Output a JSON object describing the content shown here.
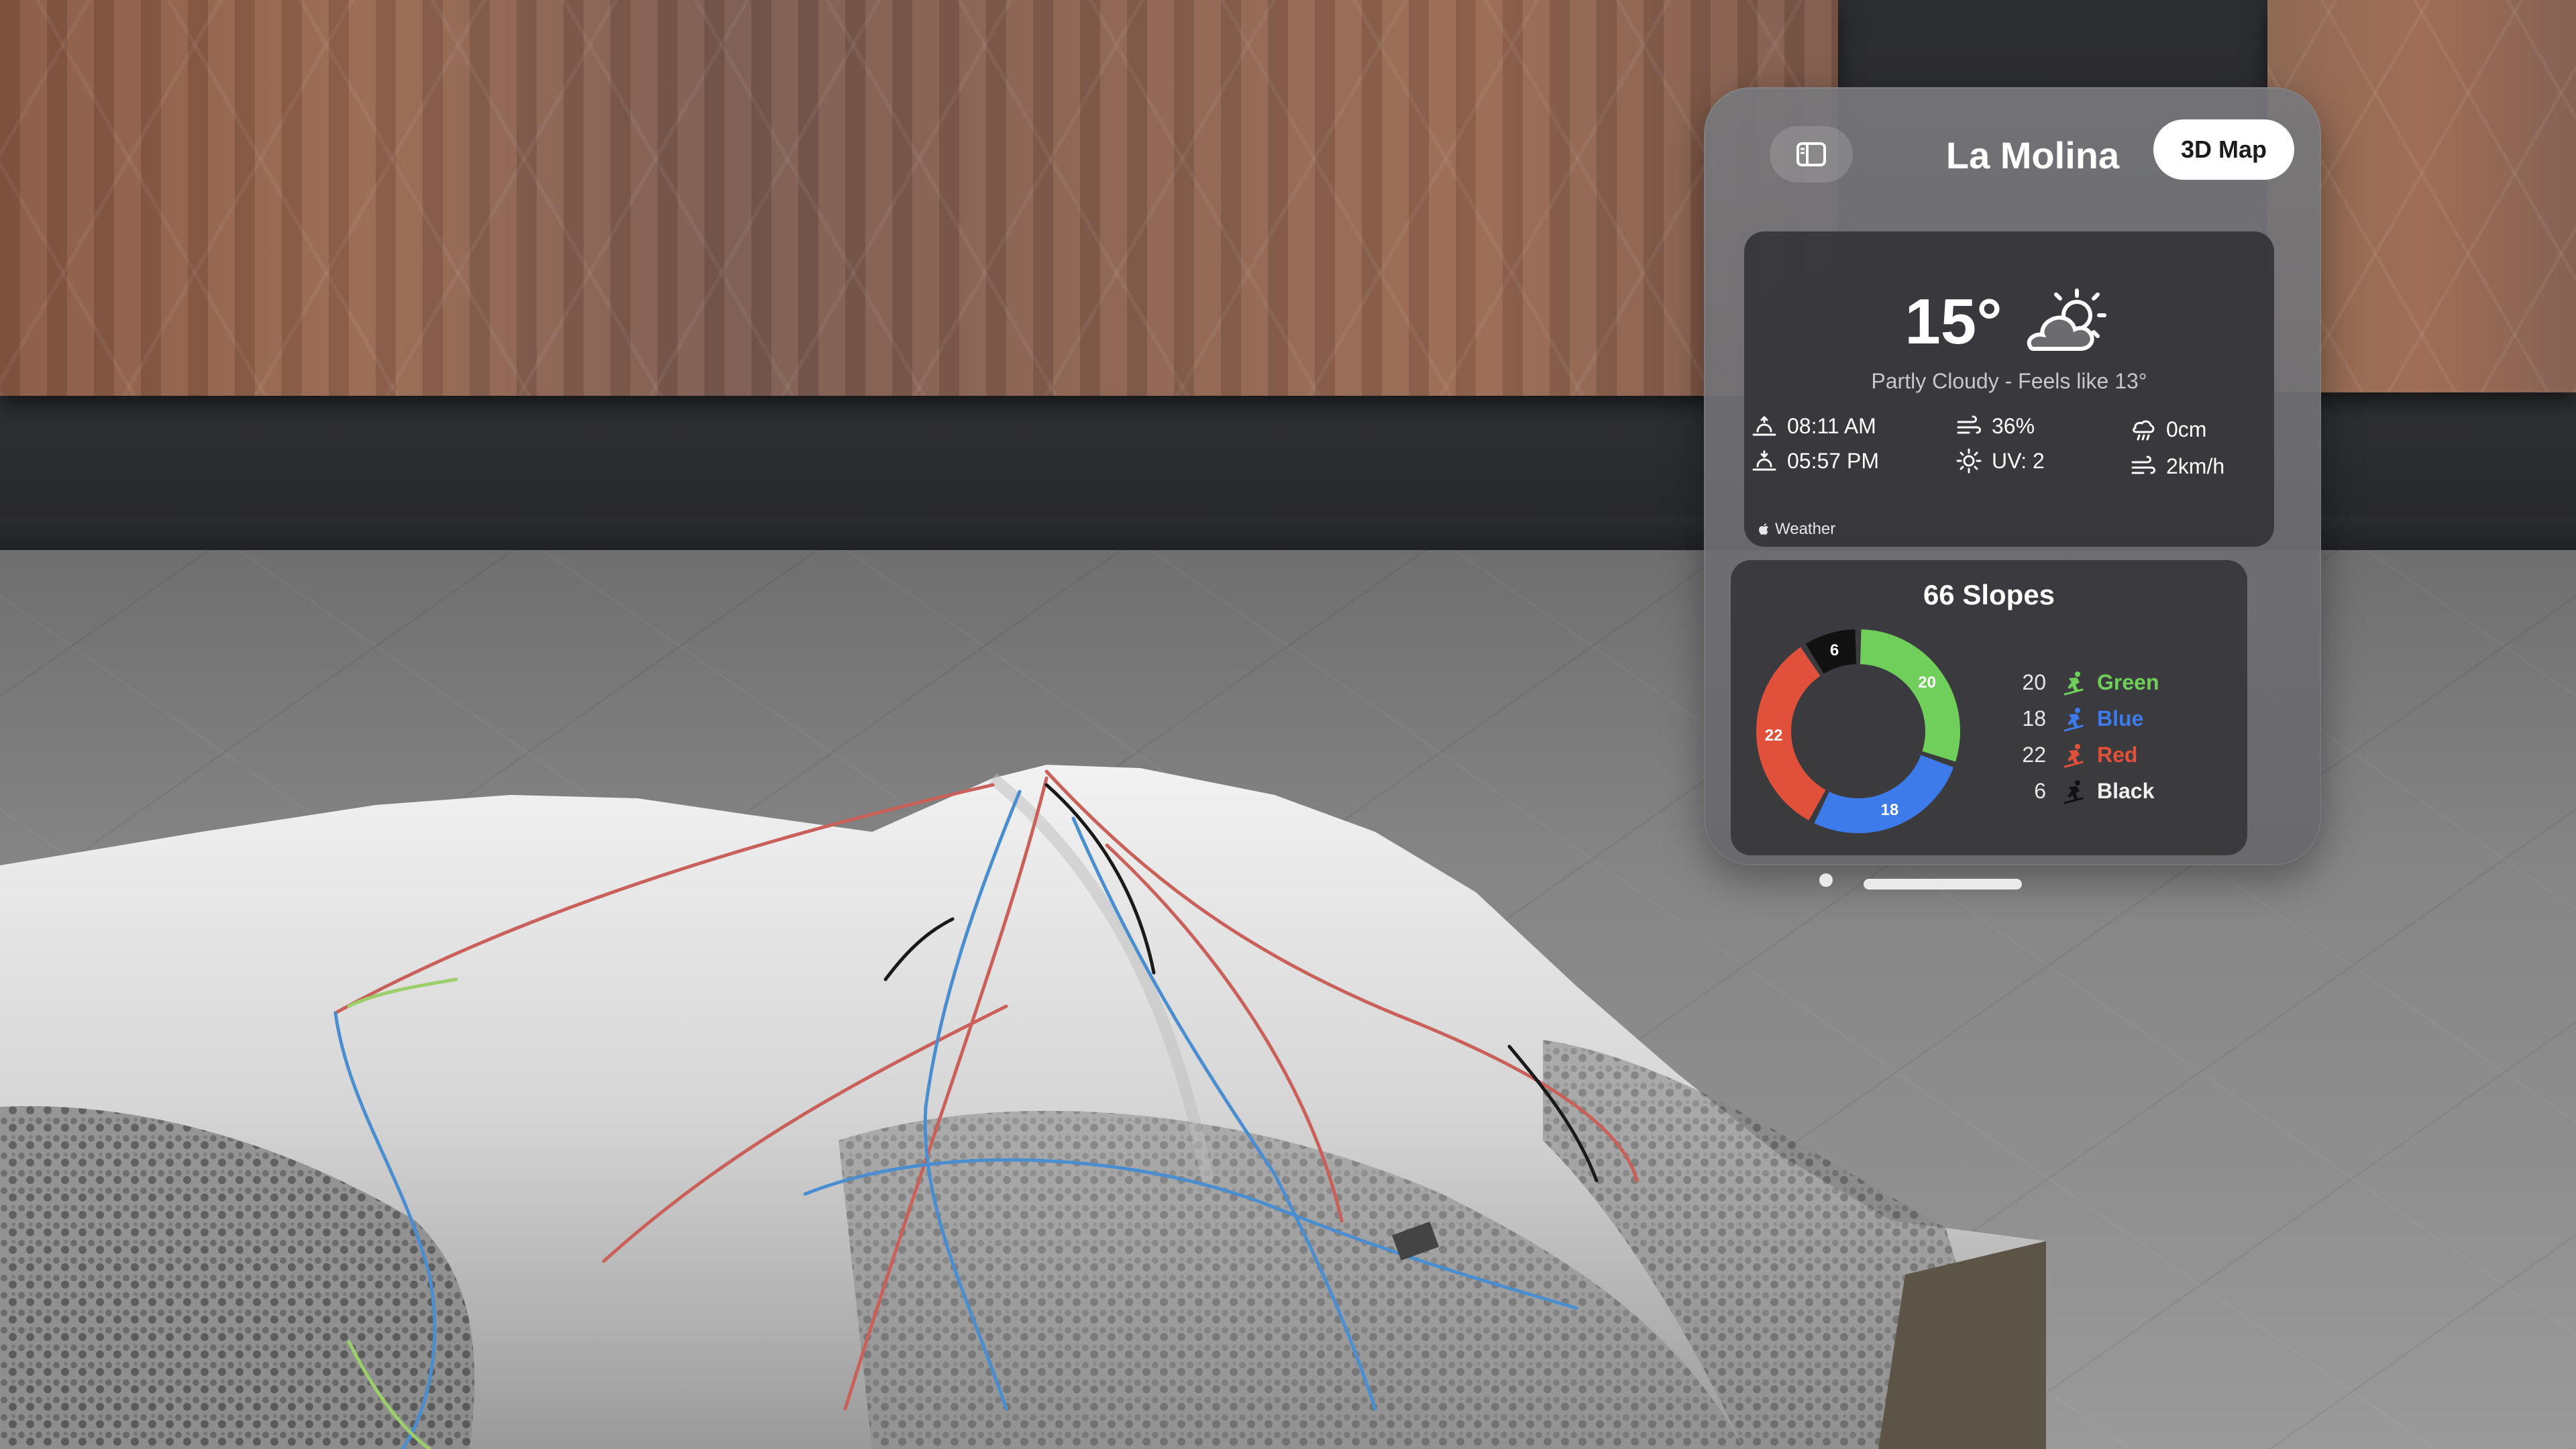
{
  "window": {
    "title": "La Molina",
    "map_button_label": "3D Map",
    "sidebar_icon": "sidebar-icon"
  },
  "weather": {
    "temperature": "15°",
    "condition_icon": "partly-cloudy-icon",
    "description": "Partly Cloudy  -  Feels like 13°",
    "sunrise": "08:11 AM",
    "sunset": "05:57 PM",
    "humidity": "36%",
    "uv": "UV: 2",
    "precipitation": "0cm",
    "wind": "2km/h",
    "attribution": "Weather"
  },
  "slopes": {
    "title": "66 Slopes",
    "items": [
      {
        "count": "20",
        "label": "Green",
        "color": "#6fcf5a"
      },
      {
        "count": "18",
        "label": "Blue",
        "color": "#3d7bea"
      },
      {
        "count": "22",
        "label": "Red",
        "color": "#e0503a"
      },
      {
        "count": "6",
        "label": "Black",
        "color": "#111111"
      }
    ]
  },
  "chart_data": {
    "type": "pie",
    "title": "66 Slopes",
    "categories": [
      "Green",
      "Blue",
      "Red",
      "Black"
    ],
    "values": [
      20,
      18,
      22,
      6
    ]
  }
}
